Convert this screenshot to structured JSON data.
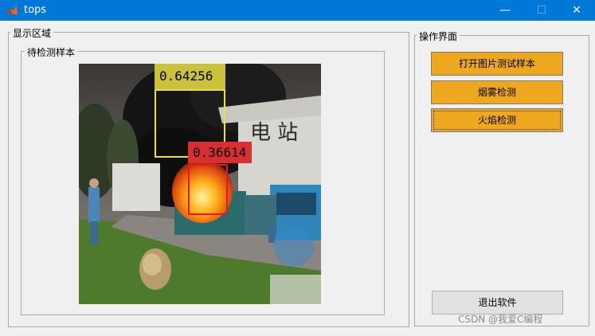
{
  "window": {
    "title": "tops",
    "minimize_glyph": "—",
    "maximize_glyph": "☐",
    "close_glyph": "✕"
  },
  "display_panel": {
    "title": "显示区域",
    "inner_title": "待检测样本"
  },
  "detections": [
    {
      "score": "0.64256",
      "color": "#e8e23a"
    },
    {
      "score": "0.36614",
      "color": "#e01c1c"
    }
  ],
  "control_panel": {
    "title": "操作界面",
    "buttons": [
      "打开图片测试样本",
      "烟雾检测",
      "火焰检测"
    ],
    "exit_label": "退出软件"
  },
  "watermark": "CSDN @我爱C编程",
  "colors": {
    "titlebar": "#0078d7",
    "button_accent": "#eda81f",
    "smoke_box": "#e8e23a",
    "fire_box": "#e01c1c"
  }
}
